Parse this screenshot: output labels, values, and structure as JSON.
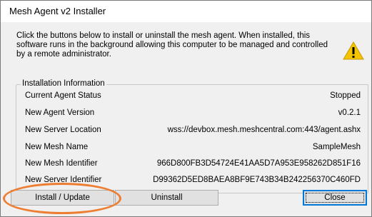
{
  "window": {
    "title": "Mesh Agent v2 Installer"
  },
  "description": "Click the buttons below to install or uninstall the mesh agent. When installed, this software runs in the background allowing this computer to be managed and controlled by a remote administrator.",
  "warning_icon": "warning-icon",
  "installation_info": {
    "legend": "Installation Information",
    "rows": [
      {
        "label": "Current Agent Status",
        "value": "Stopped"
      },
      {
        "label": "New Agent Version",
        "value": "v0.2.1"
      },
      {
        "label": "New Server Location",
        "value": "wss://devbox.mesh.meshcentral.com:443/agent.ashx"
      },
      {
        "label": "New Mesh Name",
        "value": "SampleMesh"
      },
      {
        "label": "New Mesh Identifier",
        "value": "966D800FB3D54724E41AA5D7A953E958262D851F16"
      },
      {
        "label": "New Server Identifier",
        "value": "D99362D5ED8BAEA8BF9E743B34B242256370C460FD"
      }
    ]
  },
  "buttons": {
    "install": "Install / Update",
    "uninstall": "Uninstall",
    "close": "Close"
  },
  "colors": {
    "highlight": "#ed7d31",
    "warning": "#f5c400",
    "focus": "#0078d7"
  }
}
